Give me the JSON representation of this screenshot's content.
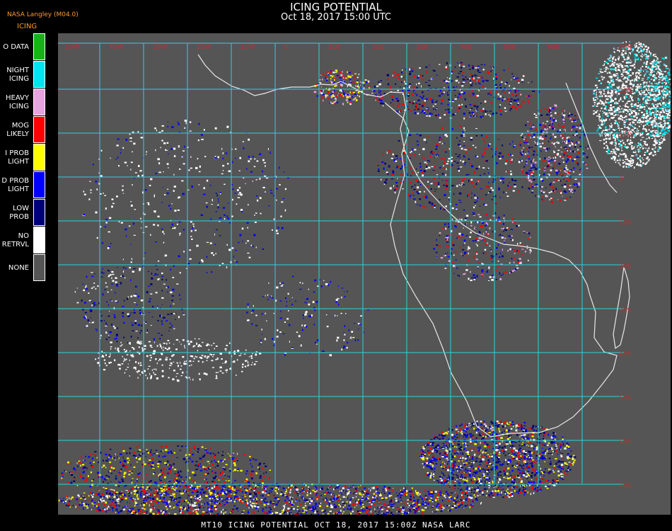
{
  "header": {
    "title": "ICING POTENTIAL",
    "subtitle": "Oct 18, 2017 15:00 UTC",
    "org": "NASA Langley (M04.0)",
    "product": "ICING"
  },
  "legend": [
    {
      "label": "O DATA",
      "color": "#14b414"
    },
    {
      "label": "NIGHT\nICING",
      "color": "#00e5ee"
    },
    {
      "label": "HEAVY\nICING",
      "color": "#e8a2e0"
    },
    {
      "label": "MOG\nLIKELY",
      "color": "#ff0000"
    },
    {
      "label": "I PROB\nLIGHT",
      "color": "#ffff00"
    },
    {
      "label": "D PROB\nLIGHT",
      "color": "#0000ff"
    },
    {
      "label": "LOW\nPROB",
      "color": "#00007a"
    },
    {
      "label": "NO\nRETRVL",
      "color": "#ffffff"
    },
    {
      "label": "NONE",
      "color": "#555555"
    }
  ],
  "map": {
    "background": "#555555",
    "grid_color": "#29d3e0",
    "coast_color": "#e8e8e8",
    "label_color": "#c03030",
    "top_labels": [
      "50W",
      "40W",
      "30W",
      "20W",
      "10W",
      "0",
      "10E",
      "20E",
      "30E",
      "40E",
      "50E",
      "60E"
    ],
    "right_labels": [
      "30N",
      "20N",
      "10N",
      "0",
      "10S",
      "20S",
      "30S",
      "40S",
      "50S",
      "60S",
      "70S"
    ]
  },
  "footer": "MT10  ICING POTENTIAL   OCT 18, 2017 15:00Z   NASA LARC"
}
